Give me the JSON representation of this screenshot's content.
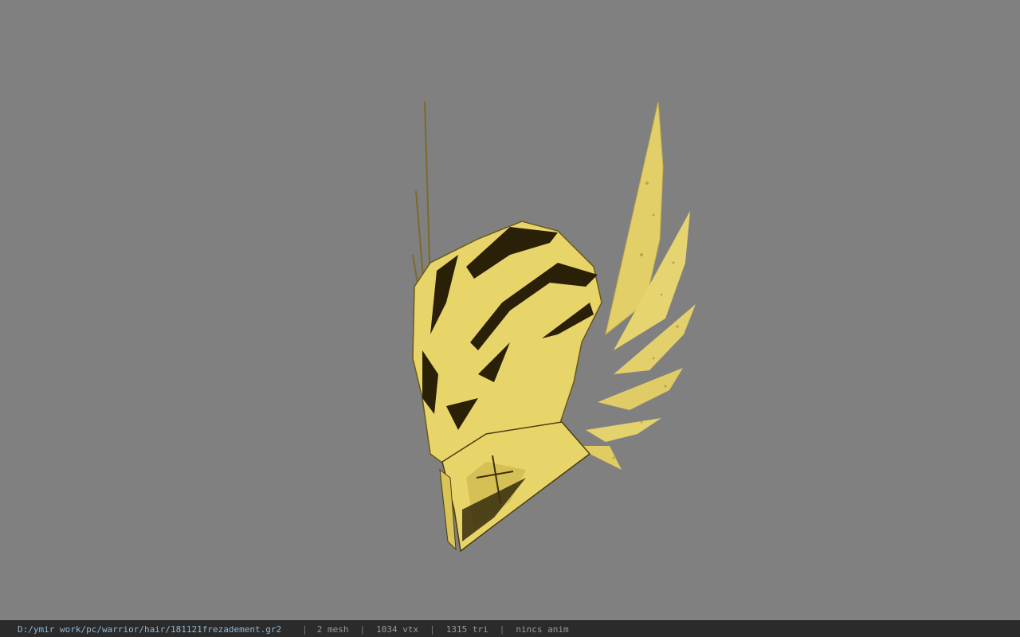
{
  "viewer": {
    "background_color": "#808080",
    "model_name": "helmet-model",
    "model_color": "#e8d56a",
    "model_shadow_color": "#2a2008"
  },
  "status": {
    "file_path": "D:/ymir work/pc/warrior/hair/181121frezadement.gr2",
    "mesh": "2 mesh",
    "vtx": "1034 vtx",
    "tri": "1315 tri",
    "anim": "nincs anim",
    "separator": "|"
  }
}
